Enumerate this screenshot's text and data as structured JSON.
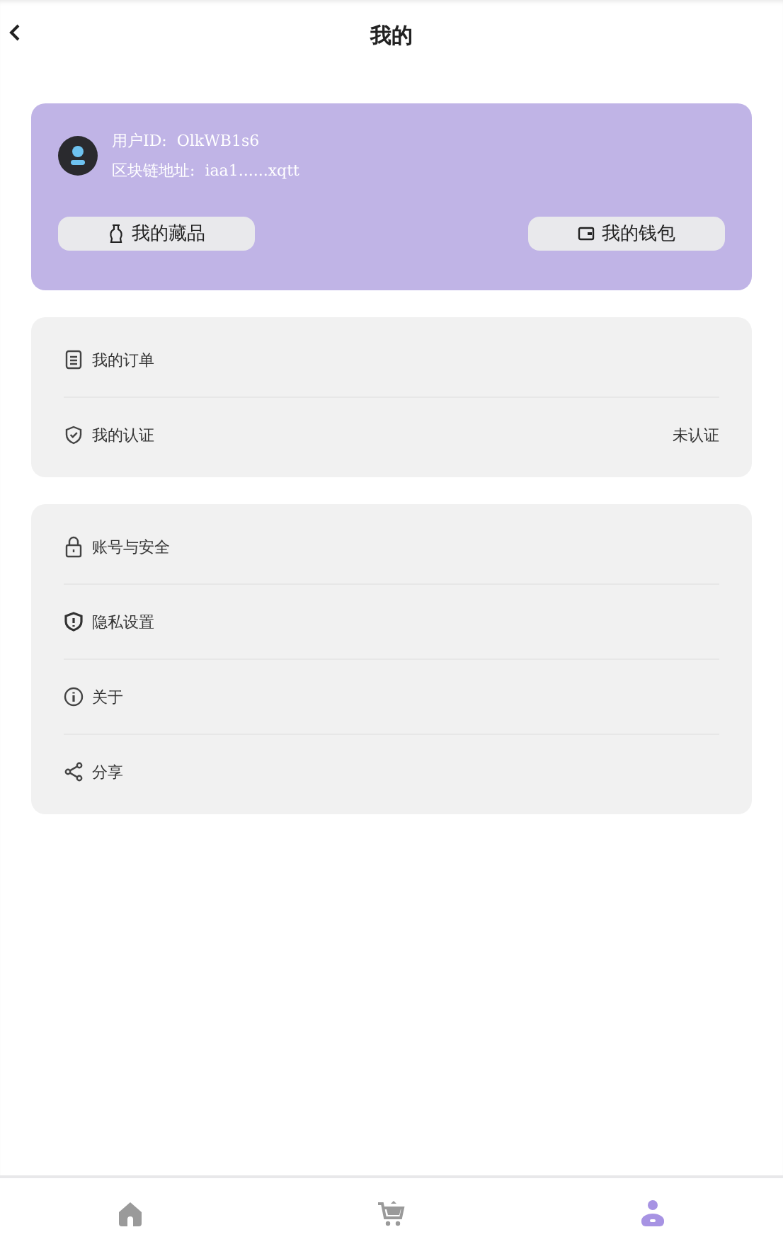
{
  "header": {
    "title": "我的"
  },
  "profile": {
    "id_label": "用户ID:",
    "id_value": "OlkWB1s6",
    "address_label": "区块链地址:",
    "address_value": "iaa1......xqtt",
    "buttons": [
      {
        "kind": "collection",
        "label": "我的藏品"
      },
      {
        "kind": "wallet",
        "label": "我的钱包"
      }
    ]
  },
  "groups": [
    [
      {
        "kind": "orders",
        "label": "我的订单"
      },
      {
        "kind": "verify",
        "label": "我的认证",
        "value": "未认证"
      }
    ],
    [
      {
        "kind": "lock",
        "label": "账号与安全"
      },
      {
        "kind": "privacy",
        "label": "隐私设置"
      },
      {
        "kind": "info",
        "label": "关于"
      },
      {
        "kind": "share",
        "label": "分享"
      }
    ]
  ],
  "tabs": [
    {
      "kind": "home",
      "selected": false
    },
    {
      "kind": "cart",
      "selected": false
    },
    {
      "kind": "user",
      "selected": true
    }
  ]
}
